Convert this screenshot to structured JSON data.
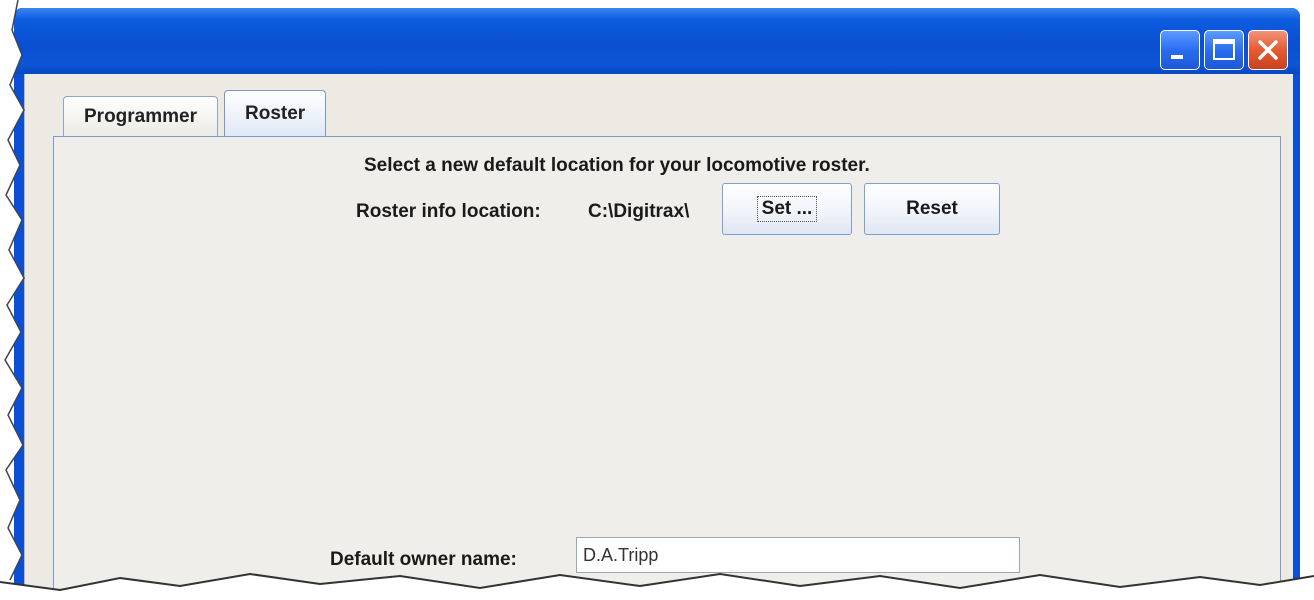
{
  "window": {
    "controls": {
      "minimize_icon": "minimize-icon",
      "maximize_icon": "maximize-icon",
      "close_icon": "close-icon"
    }
  },
  "tabs": [
    {
      "label": "Programmer",
      "active": false
    },
    {
      "label": "Roster",
      "active": true
    }
  ],
  "roster": {
    "headline": "Select a new default location for your locomotive roster.",
    "location_label": "Roster info location:",
    "location_value": "C:\\Digitrax\\",
    "set_button": "Set ...",
    "reset_button": "Reset",
    "owner_label": "Default owner name:",
    "owner_value": "D.A.Tripp"
  },
  "colors": {
    "titlebar": "#0a4fd0",
    "panel_bg": "#efeeea",
    "close_button": "#e55a32"
  }
}
